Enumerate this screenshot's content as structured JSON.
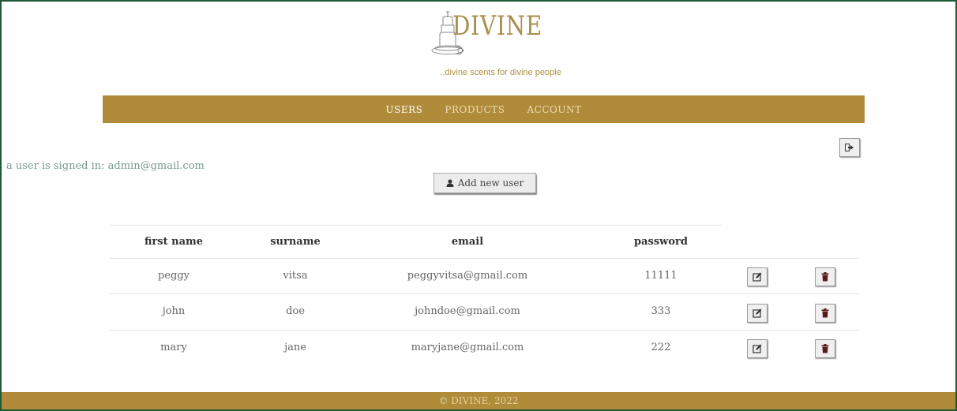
{
  "brand": {
    "name": "DIVINE",
    "tagline": "..divine scents for divine people",
    "accent": "#af8b3a"
  },
  "nav": {
    "items": [
      {
        "label": "USERS",
        "active": true
      },
      {
        "label": "PRODUCTS",
        "active": false
      },
      {
        "label": "ACCOUNT",
        "active": false
      }
    ]
  },
  "session": {
    "signed_in_text": "a user is signed in: admin@gmail.com",
    "logout_icon": "sign-out-icon"
  },
  "actions": {
    "add_user_label": "Add new user",
    "add_user_icon": "user-icon"
  },
  "table": {
    "headers": [
      "first name",
      "surname",
      "email",
      "password"
    ],
    "rows": [
      {
        "first_name": "peggy",
        "surname": "vitsa",
        "email": "peggyvitsa@gmail.com",
        "password": "11111"
      },
      {
        "first_name": "john",
        "surname": "doe",
        "email": "johndoe@gmail.com",
        "password": "333"
      },
      {
        "first_name": "mary",
        "surname": "jane",
        "email": "maryjane@gmail.com",
        "password": "222"
      }
    ],
    "edit_icon": "edit-icon",
    "delete_icon": "trash-icon"
  },
  "footer": {
    "text": "© DIVINE, 2022"
  }
}
